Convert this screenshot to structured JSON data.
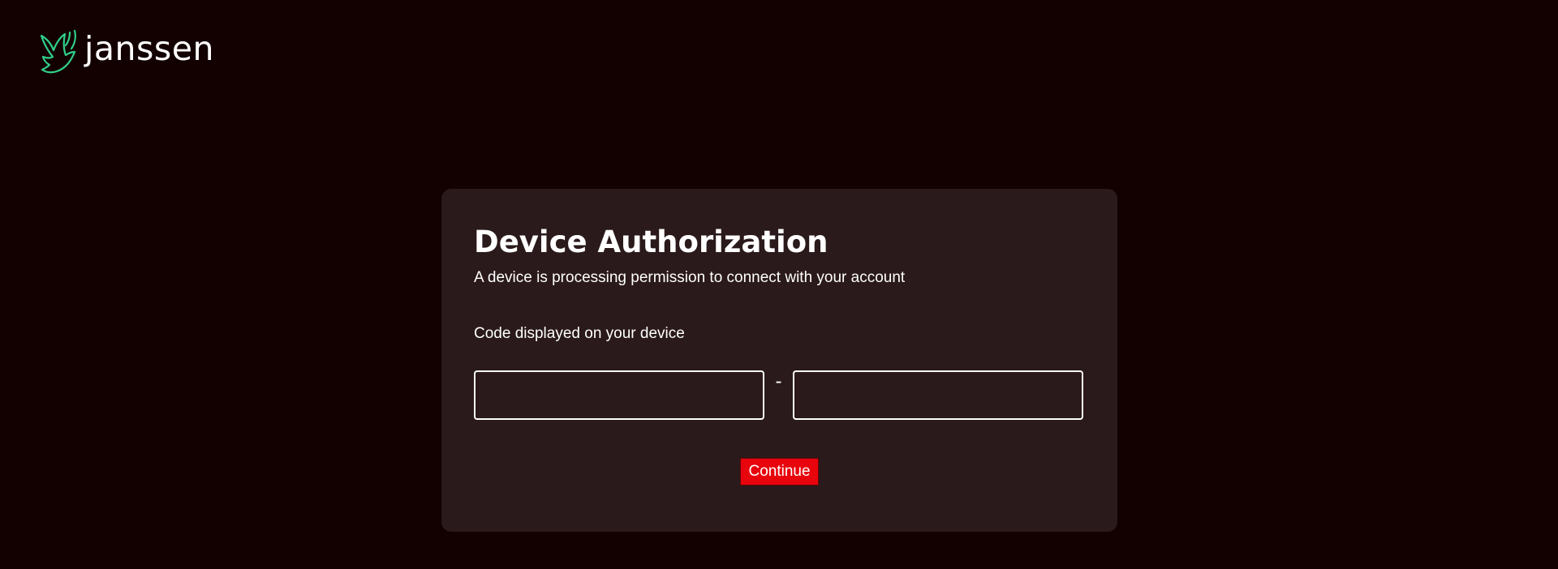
{
  "header": {
    "logo_text": "janssen",
    "logo_icon": "bird-icon",
    "logo_color": "#2fd08a"
  },
  "card": {
    "title": "Device Authorization",
    "subtitle": "A device is processing permission to connect with your account",
    "code_label": "Code displayed on your device",
    "code_part1": {
      "value": "",
      "placeholder": ""
    },
    "separator": "-",
    "code_part2": {
      "value": "",
      "placeholder": ""
    },
    "continue_label": "Continue"
  },
  "colors": {
    "page_background": "#130102",
    "card_background": "#2b1a1b",
    "accent_button": "#e8040c"
  }
}
